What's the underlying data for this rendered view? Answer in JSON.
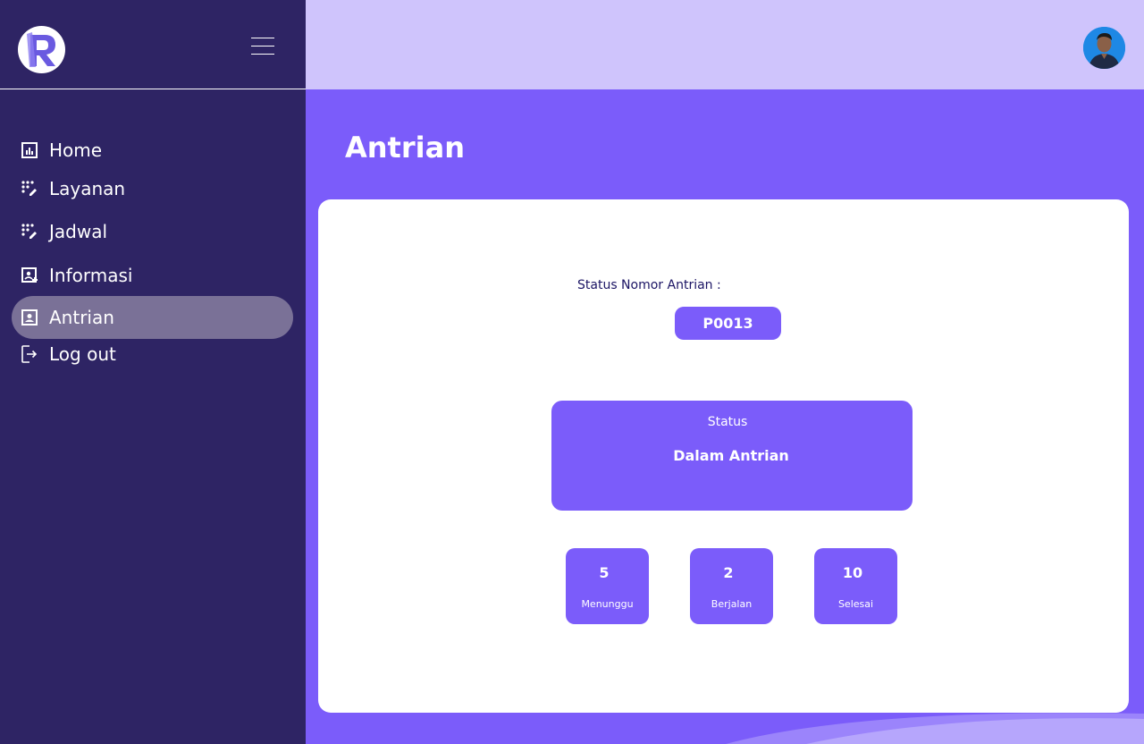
{
  "sidebar": {
    "logo_letter": "R",
    "items": [
      {
        "label": "Home",
        "icon": "dashboard-chart-icon"
      },
      {
        "label": "Layanan",
        "icon": "grid-edit-icon"
      },
      {
        "label": "Jadwal",
        "icon": "grid-edit-icon"
      },
      {
        "label": "Informasi",
        "icon": "add-info-icon"
      },
      {
        "label": "Antrian",
        "icon": "person-badge-icon",
        "active": true
      },
      {
        "label": "Log out",
        "icon": "logout-icon"
      }
    ]
  },
  "page": {
    "title": "Antrian"
  },
  "queue": {
    "status_label": "Status Nomor Antrian :",
    "ticket_number": "P0013",
    "status_title": "Status",
    "status_value": "Dalam Antrian",
    "stats": [
      {
        "value": "5",
        "label": "Menunggu"
      },
      {
        "value": "2",
        "label": "Berjalan"
      },
      {
        "value": "10",
        "label": "Selesai"
      }
    ]
  },
  "colors": {
    "sidebar_bg": "#2e2464",
    "header_bg": "#cfc4fc",
    "accent": "#7b5cfa",
    "active_item_bg": "#7a7197",
    "label_text": "#1b1464"
  }
}
